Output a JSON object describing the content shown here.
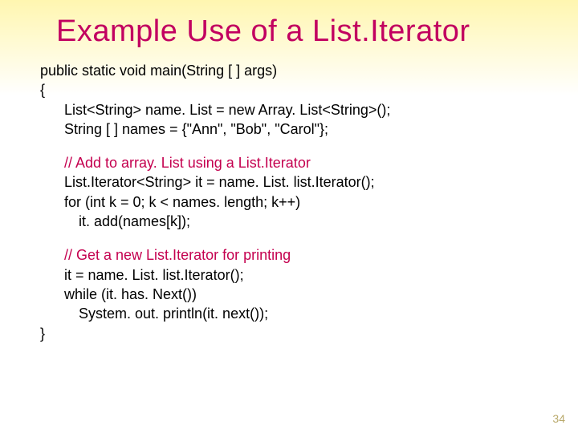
{
  "title": "Example Use of a List.Iterator",
  "code": {
    "sig": "public  static void main(String [ ] args)",
    "open": "{",
    "l1": "List<String> name. List = new Array. List<String>();",
    "l2": "String [ ] names = {\"Ann\", \"Bob\", \"Carol\"};",
    "c1": "// Add to array. List using a List.Iterator",
    "l3": "List.Iterator<String> it = name. List. list.Iterator();",
    "l4": "for (int k = 0; k < names. length; k++)",
    "l5": "it. add(names[k]);",
    "c2": "// Get a new  List.Iterator for printing",
    "l6": "it = name. List. list.Iterator();",
    "l7": "while (it. has. Next())",
    "l8": "System. out. println(it. next());",
    "close": "}"
  },
  "page": "34"
}
